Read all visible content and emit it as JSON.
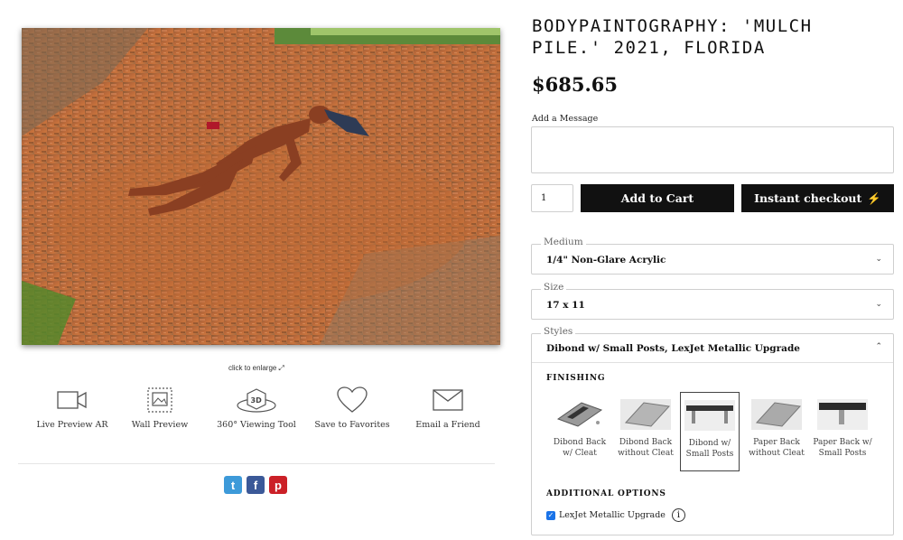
{
  "product": {
    "title": "BODYPAINTOGRAPHY: 'MULCH PILE.' 2021, FLORIDA",
    "price": "$685.65",
    "image_alt_icon": "photo-artwork"
  },
  "enlarge": {
    "label": "click to enlarge",
    "icon": "expand-arrow-icon"
  },
  "tools": [
    {
      "label": "Live Preview AR",
      "icon": "video-camera-icon"
    },
    {
      "label": "Wall Preview",
      "icon": "wall-frame-icon"
    },
    {
      "label": "360° Viewing Tool",
      "icon": "3d-cube-icon"
    },
    {
      "label": "Save to Favorites",
      "icon": "heart-icon"
    },
    {
      "label": "Email a Friend",
      "icon": "envelope-icon"
    }
  ],
  "social": [
    {
      "name": "twitter",
      "glyph": "t",
      "color": "#3d9ad9"
    },
    {
      "name": "facebook",
      "glyph": "f",
      "color": "#3b5998"
    },
    {
      "name": "pinterest",
      "glyph": "p",
      "color": "#cb2027"
    }
  ],
  "message": {
    "label": "Add a Message",
    "value": ""
  },
  "quantity": {
    "value": "1"
  },
  "buttons": {
    "add_to_cart": "Add to Cart",
    "instant_checkout": "Instant checkout",
    "instant_icon": "lightning-icon"
  },
  "medium": {
    "legend": "Medium",
    "value": "1/4\" Non-Glare Acrylic"
  },
  "size": {
    "legend": "Size",
    "value": "17 x 11"
  },
  "styles": {
    "legend": "Styles",
    "value": "Dibond w/ Small Posts, LexJet Metallic Upgrade",
    "finishing_title": "FINISHING",
    "options": [
      {
        "label": "Dibond Back w/ Cleat",
        "selected": false
      },
      {
        "label": "Dibond Back without Cleat",
        "selected": false
      },
      {
        "label": "Dibond w/ Small Posts",
        "selected": true
      },
      {
        "label": "Paper Back without Cleat",
        "selected": false
      },
      {
        "label": "Paper Back w/ Small Posts",
        "selected": false
      }
    ],
    "additional_title": "ADDITIONAL OPTIONS",
    "addon": {
      "label": "LexJet Metallic Upgrade",
      "checked": true,
      "info_icon": "info-icon"
    }
  }
}
